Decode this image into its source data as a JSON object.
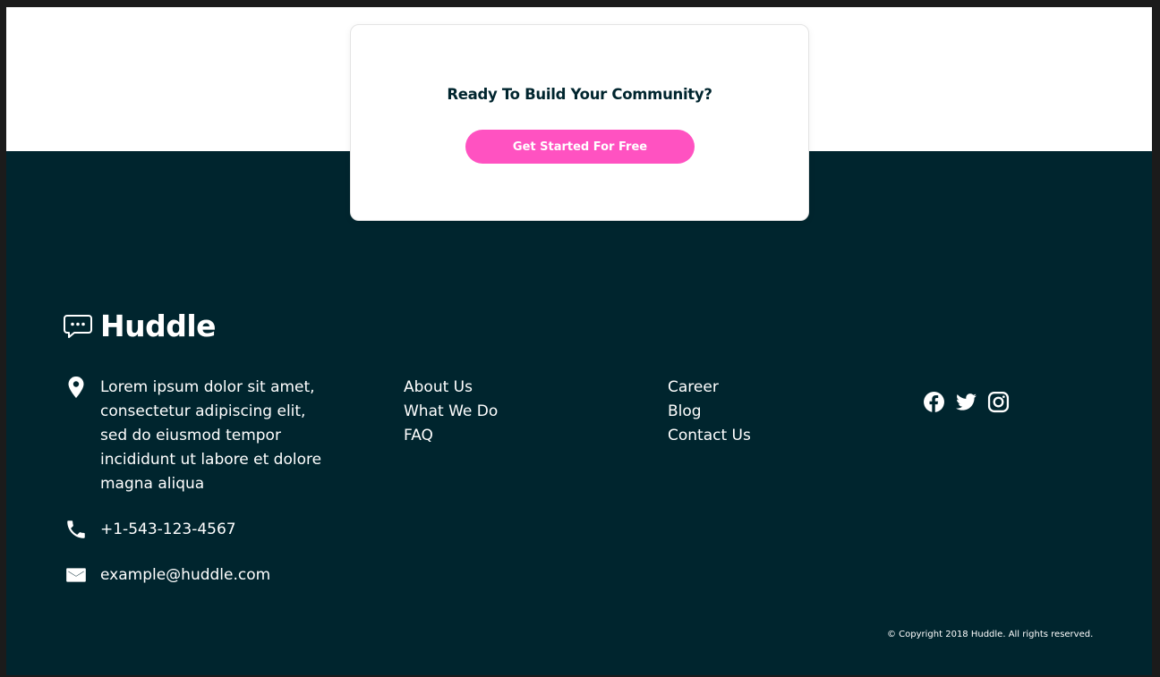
{
  "cta": {
    "title": "Ready To Build Your Community?",
    "button_label": "Get Started For Free"
  },
  "footer": {
    "logo_text": "Huddle",
    "contact": {
      "address": "Lorem ipsum dolor sit amet, consectetur adipiscing elit, sed do eiusmod tempor incididunt ut labore et dolore magna aliqua",
      "phone": "+1-543-123-4567",
      "email": "example@huddle.com"
    },
    "links_col1": [
      "About Us",
      "What We Do",
      "FAQ"
    ],
    "links_col2": [
      "Career",
      "Blog",
      "Contact Us"
    ],
    "social_icons": [
      "facebook-icon",
      "twitter-icon",
      "instagram-icon"
    ],
    "copyright": "© Copyright 2018 Huddle. All rights reserved."
  },
  "colors": {
    "footer_bg": "#00252e",
    "button_pink": "#ff52c1",
    "text_dark": "#00252e",
    "white": "#ffffff"
  }
}
